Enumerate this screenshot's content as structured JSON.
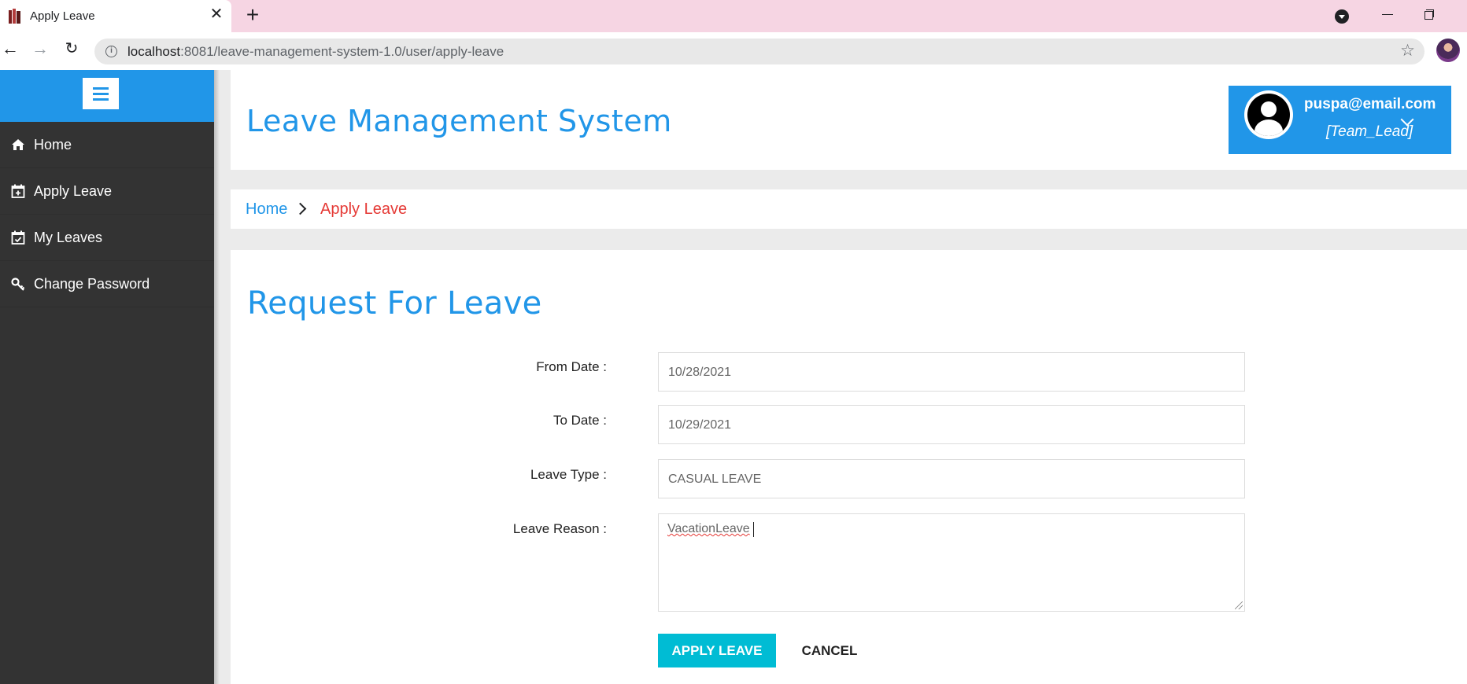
{
  "browser": {
    "tab_title": "Apply Leave",
    "url_host": "localhost",
    "url_rest": ":8081/leave-management-system-1.0/user/apply-leave"
  },
  "sidebar": {
    "items": [
      {
        "label": "Home",
        "icon": "home-icon"
      },
      {
        "label": "Apply Leave",
        "icon": "calendar-plus-icon"
      },
      {
        "label": "My Leaves",
        "icon": "calendar-check-icon"
      },
      {
        "label": "Change Password",
        "icon": "key-icon"
      }
    ]
  },
  "header": {
    "title": "Leave Management System",
    "user_email": "puspa@email.com",
    "user_role": "[Team_Lead]"
  },
  "breadcrumb": {
    "home": "Home",
    "current": "Apply Leave"
  },
  "form": {
    "title": "Request For Leave",
    "from_date_label": "From Date :",
    "from_date_value": "10/28/2021",
    "to_date_label": "To Date :",
    "to_date_value": "10/29/2021",
    "leave_type_label": "Leave Type :",
    "leave_type_value": "CASUAL LEAVE",
    "leave_reason_label": "Leave Reason :",
    "leave_reason_value": "VacationLeave",
    "apply_label": "APPLY LEAVE",
    "cancel_label": "CANCEL"
  },
  "colors": {
    "primary": "#2196e8",
    "sidebar_bg": "#333333",
    "accent_button": "#00bcd4",
    "breadcrumb_current": "#e53935",
    "tabstrip": "#f6d5e3"
  }
}
